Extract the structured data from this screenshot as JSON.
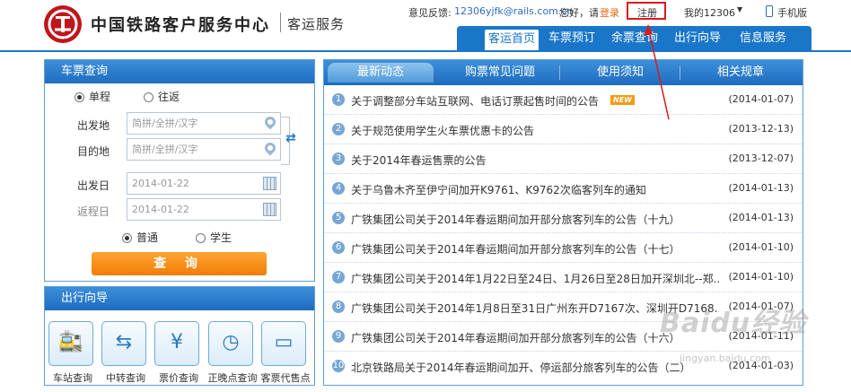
{
  "header": {
    "brand": "中国铁路客户服务中心",
    "sub": "客运服务",
    "feedback_label": "意见反馈:",
    "email": "12306yjfk@rails.com.cn",
    "hello": "您好，请",
    "login": "登录",
    "register": "注册",
    "my12306": "我的12306",
    "caret": "▼",
    "mobile": "手机版"
  },
  "nav": {
    "items": [
      {
        "label": "客运首页"
      },
      {
        "label": "车票预订"
      },
      {
        "label": "余票查询"
      },
      {
        "label": "出行向导"
      },
      {
        "label": "信息服务"
      }
    ]
  },
  "ticket": {
    "title": "车票查询",
    "trip_types": [
      {
        "label": "单程",
        "checked": true
      },
      {
        "label": "往返",
        "checked": false
      }
    ],
    "from_label": "出发地",
    "from_placeholder": "简拼/全拼/汉字",
    "to_label": "目的地",
    "to_placeholder": "简拼/全拼/汉字",
    "depart_label": "出发日",
    "depart_value": "2014-01-22",
    "return_label": "返程日",
    "return_value": "2014-01-22",
    "passenger_types": [
      {
        "label": "普通",
        "checked": true
      },
      {
        "label": "学生",
        "checked": false
      }
    ],
    "search_label": "查 询",
    "swap_glyph": "⇄"
  },
  "guide": {
    "title": "出行向导",
    "items": [
      {
        "label": "车站查询",
        "icon": "station-icon",
        "glyph": "🚉"
      },
      {
        "label": "中转查询",
        "icon": "transfer-icon",
        "glyph": "⇆"
      },
      {
        "label": "票价查询",
        "icon": "fare-icon",
        "glyph": "¥"
      },
      {
        "label": "正晚点查询",
        "icon": "clock-icon",
        "glyph": "◷"
      },
      {
        "label": "客票代售点",
        "icon": "ticket-office-icon",
        "glyph": "▭"
      }
    ]
  },
  "news": {
    "tabs": [
      {
        "label": "最新动态"
      },
      {
        "label": "购票常见问题"
      },
      {
        "label": "使用须知"
      },
      {
        "label": "相关规章"
      }
    ],
    "new_badge": "NEW",
    "items": [
      {
        "n": "1",
        "title": "关于调整部分车站互联网、电话订票起售时间的公告",
        "date": "(2014-01-07)"
      },
      {
        "n": "2",
        "title": "关于规范使用学生火车票优惠卡的公告",
        "date": "(2013-12-13)"
      },
      {
        "n": "3",
        "title": "关于2014年春运售票的公告",
        "date": "(2013-12-07)"
      },
      {
        "n": "4",
        "title": "关于乌鲁木齐至伊宁间加开K9761、K9762次临客列车的通知",
        "date": "(2014-01-13)"
      },
      {
        "n": "5",
        "title": "广铁集团公司关于2014年春运期间加开部分旅客列车的公告（十九）",
        "date": "(2014-01-13)"
      },
      {
        "n": "6",
        "title": "广铁集团公司关于2014年春运期间加开部分旅客列车的公告（十七）",
        "date": "(2014-01-10)"
      },
      {
        "n": "7",
        "title": "广铁集团公司关于2014年1月22日至24日、1月26日至28日加开深圳北--郑...",
        "date": "(2014-01-10)"
      },
      {
        "n": "8",
        "title": "广铁集团公司关于2014年1月8日至31日广州东开D7167次、深圳开D7168...",
        "date": "(2014-01-07)"
      },
      {
        "n": "9",
        "title": "广铁集团公司关于2014年春运期间加开部分旅客列车的公告（十六）",
        "date": "(2014-01-11)"
      },
      {
        "n": "10",
        "title": "北京铁路局关于2014年春运期间加开、停运部分旅客列车的公告（二）",
        "date": "(2014-01-03)"
      }
    ]
  },
  "watermark": {
    "brand": "Baidu经验",
    "url": "jingyan.baidu.com"
  },
  "colors": {
    "primary": "#1a76c9",
    "accent": "#f27d07",
    "logo": "#c0151b",
    "annotation": "#d8191f"
  }
}
